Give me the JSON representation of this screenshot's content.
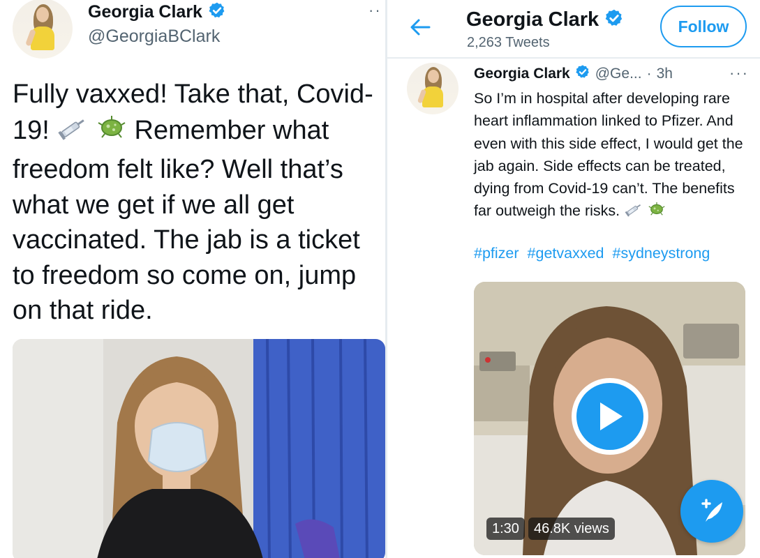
{
  "left_tweet": {
    "author_name": "Georgia Clark",
    "author_handle": "@GeorgiaBClark",
    "more_label": "··",
    "text": "Fully vaxxed! Take that, Covid-19! 💉 🦠 Remember what freedom felt like? Well that’s what we get if we all get vaccinated. The jab is a ticket to freedom so come on, jump on that ride.",
    "text_parts": {
      "a": "Fully vaxxed! Take that, Covid-19!",
      "b": "Remember what freedom felt like? Well that’s what we get if we all get vaccinated. The jab is a ticket to freedom so come on, jump on that ride."
    }
  },
  "profile_header": {
    "back_icon": "arrow-left-icon",
    "title": "Georgia Clark",
    "tweet_count": "2,263 Tweets",
    "follow_label": "Follow"
  },
  "right_tweet": {
    "author_name": "Georgia Clark",
    "author_handle": "@Ge...",
    "separator": "·",
    "time": "3h",
    "more_label": "···",
    "text_main": "So I’m in hospital after developing rare heart inflammation linked to Pfizer. And even with this side effect, I would get the jab again. Side effects can be treated, dying from Covid-19 can’t. The benefits far outweigh the risks.",
    "hashtags": [
      "#pfizer",
      "#getvaxxed",
      "#sydneystrong"
    ],
    "video": {
      "duration": "1:30",
      "views": "46.8K views"
    }
  },
  "icons": {
    "verified": "verified-badge-icon",
    "syringe": "syringe-emoji-icon",
    "microbe": "microbe-emoji-icon",
    "play": "play-icon",
    "compose": "compose-tweet-icon"
  },
  "colors": {
    "accent": "#1d9bf0",
    "text_primary": "#0f1419",
    "text_secondary": "#536471"
  }
}
